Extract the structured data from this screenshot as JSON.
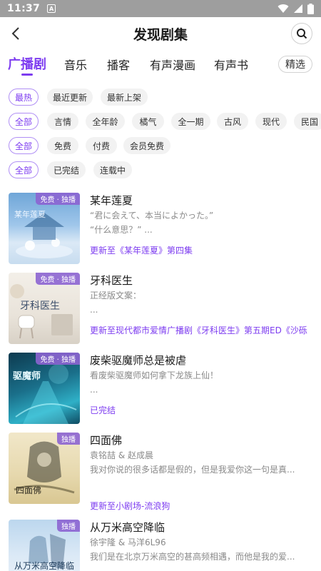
{
  "status_bar": {
    "time": "11:37",
    "notification_glyph": "A"
  },
  "header": {
    "title": "发现剧集"
  },
  "tabs": [
    {
      "label": "广播剧",
      "active": true
    },
    {
      "label": "音乐",
      "active": false
    },
    {
      "label": "播客",
      "active": false
    },
    {
      "label": "有声漫画",
      "active": false
    },
    {
      "label": "有声书",
      "active": false
    }
  ],
  "filter_button": "精选",
  "filters": {
    "sort": [
      "最热",
      "最近更新",
      "最新上架"
    ],
    "genre": [
      "全部",
      "言情",
      "全年龄",
      "橘气",
      "全一期",
      "古风",
      "现代",
      "民国"
    ],
    "pay": [
      "全部",
      "免费",
      "付费",
      "会员免费"
    ],
    "status": [
      "全部",
      "已完结",
      "连载中"
    ]
  },
  "colors": {
    "accent": "#7d3cf0",
    "badge": "#8c64d2",
    "chip_bg": "#f2f2f2"
  },
  "items": [
    {
      "title": "某年莲夏",
      "line1": "“君に会えて、本当によかった。”",
      "line2": "“什么意思？” ...",
      "update": "更新至《某年莲夏》第四集",
      "badge": "免费 · 独播",
      "cover_text": "某年莲夏"
    },
    {
      "title": "牙科医生",
      "line1": "正经版文案：",
      "line2": "...",
      "update": "更新至现代都市爱情广播剧《牙科医生》第五期ED《沙砾",
      "badge": "免费 · 独播",
      "cover_text": "牙科医生"
    },
    {
      "title": "废柴驱魔师总是被虐",
      "line1": "看废柴驱魔师如何拿下龙族上仙！",
      "line2": "...",
      "update": "已完结",
      "badge": "免费 · 独播",
      "cover_text": "驱魔师"
    },
    {
      "title": "四面佛",
      "line1": "袁铭喆 & 赵成晨",
      "line2": "我对你说的很多话都是假的，但是我爱你这一句是真...",
      "update": "更新至小剧场-流浪狗",
      "badge": "独播",
      "cover_text": "四面佛"
    },
    {
      "title": "从万米高空降临",
      "line1": "徐宇隆 & 马洋6L96",
      "line2": "我们是在北京万米高空的甚高频相遇，而他是我的爱...",
      "update": "",
      "badge": "独播",
      "cover_text": "从万米高空降临"
    }
  ]
}
